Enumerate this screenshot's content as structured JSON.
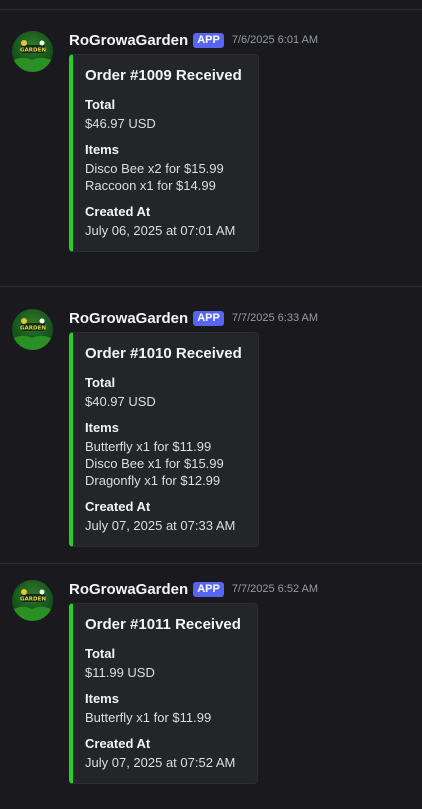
{
  "messages": [
    {
      "author": "RoGrowaGarden",
      "badge": "APP",
      "timestamp": "7/6/2025 6:01 AM",
      "avatar_icon": "rogrowagarden-logo",
      "embed": {
        "accent_color": "#23d21f",
        "title": "Order #1009 Received",
        "total_label": "Total",
        "total_value": "$46.97 USD",
        "items_label": "Items",
        "items": [
          "Disco Bee x2 for $15.99",
          "Raccoon x1 for $14.99"
        ],
        "created_label": "Created At",
        "created_value": "July 06, 2025 at 07:01 AM"
      }
    },
    {
      "author": "RoGrowaGarden",
      "badge": "APP",
      "timestamp": "7/7/2025 6:33 AM",
      "avatar_icon": "rogrowagarden-logo",
      "embed": {
        "accent_color": "#23d21f",
        "title": "Order #1010 Received",
        "total_label": "Total",
        "total_value": "$40.97 USD",
        "items_label": "Items",
        "items": [
          "Butterfly x1 for $11.99",
          "Disco Bee x1 for $15.99",
          "Dragonfly x1 for $12.99"
        ],
        "created_label": "Created At",
        "created_value": "July 07, 2025 at 07:33 AM"
      }
    },
    {
      "author": "RoGrowaGarden",
      "badge": "APP",
      "timestamp": "7/7/2025 6:52 AM",
      "avatar_icon": "rogrowagarden-logo",
      "embed": {
        "accent_color": "#23d21f",
        "title": "Order #1011 Received",
        "total_label": "Total",
        "total_value": "$11.99 USD",
        "items_label": "Items",
        "items": [
          "Butterfly x1 for $11.99"
        ],
        "created_label": "Created At",
        "created_value": "July 07, 2025 at 07:52 AM"
      }
    }
  ]
}
